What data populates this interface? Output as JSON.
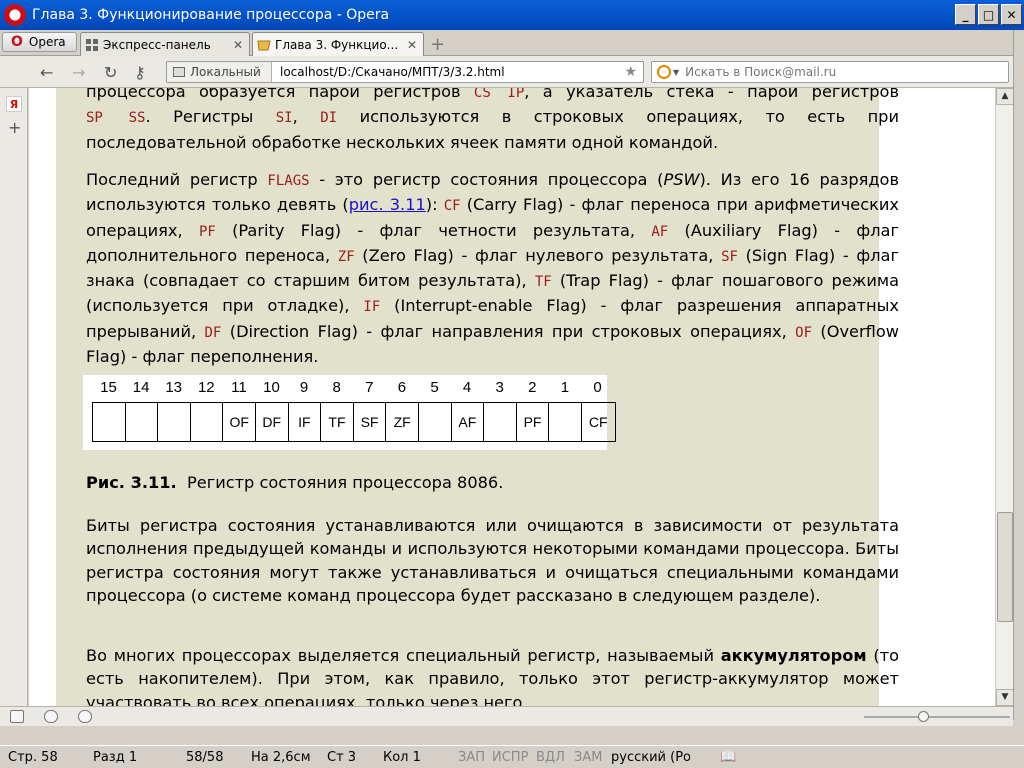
{
  "window": {
    "title": "Глава 3. Функционирование процессора - Opera",
    "buttons": [
      "_",
      "□",
      "✕"
    ]
  },
  "tabs": {
    "menu_label": "Opera",
    "items": [
      {
        "label": "Экспресс-панель",
        "close": "✕"
      },
      {
        "label": "Глава 3. Функцио...",
        "close": "✕"
      }
    ],
    "new_tab": "+"
  },
  "addressbar": {
    "back": "←",
    "forward": "→",
    "reload": "↻",
    "key": "⚷",
    "local_label": "Локальный",
    "url": "localhost/D:/Скачано/МПТ/3/3.2.html",
    "star": "★",
    "search_placeholder": "Искать в Поиск@mail.ru"
  },
  "sidepanel": {
    "y": "Я",
    "plus": "+"
  },
  "content": {
    "para0": {
      "l1_a": "процессора образуется парой регистров ",
      "l1_code1": "CS IP",
      "l1_b": ", а указатель стека - парой регистров",
      "l2_code1": "SP SS",
      "l2_a": ". Регистры ",
      "l2_code2": "SI",
      "l2_b": ", ",
      "l2_code3": "DI",
      "l2_c": " используются в строковых операциях, то есть при",
      "l3": "последовательной обработке нескольких ячеек памяти одной командой."
    },
    "para1": {
      "a": "Последний регистр ",
      "flags": "FLAGS",
      "b": " - это регистр состояния процессора (",
      "psw": "PSW",
      "c": "). Из его 16 разрядов используются только девять (",
      "link": "рис. 3.11",
      "d": "): ",
      "cf": "CF",
      "e": " (Carry Flag) - флаг переноса при арифметических операциях, ",
      "pf": "PF",
      "f": " (Parity Flag) - флаг четности результата, ",
      "af": "AF",
      "g": " (Auxiliary Flag) - флаг дополнительного переноса, ",
      "zf": "ZF",
      "h": " (Zero Flag) - флаг нулевого результата, ",
      "sf": "SF",
      "i": " (Sign Flag) - флаг знака (совпадает со старшим битом результата), ",
      "tf": "TF",
      "j": " (Trap Flag) - флаг пошагового режима (используется при отладке), ",
      "iflag": "IF",
      "k": " (Interrupt-enable Flag) - флаг разрешения аппаратных прерываний, ",
      "df": "DF",
      "l": " (Direction Flag) - флаг направления при строковых операциях, ",
      "of": "OF",
      "m": " (Overflow Flag) - флаг переполнения."
    },
    "register": {
      "bits": [
        "15",
        "14",
        "13",
        "12",
        "11",
        "10",
        "9",
        "8",
        "7",
        "6",
        "5",
        "4",
        "3",
        "2",
        "1",
        "0"
      ],
      "cells": [
        "",
        "",
        "",
        "",
        "OF",
        "DF",
        "IF",
        "TF",
        "SF",
        "ZF",
        "",
        "AF",
        "",
        "PF",
        "",
        "CF"
      ]
    },
    "caption": {
      "label": "Рис. 3.11.",
      "text": "Регистр состояния процессора 8086."
    },
    "para2": "Биты регистра состояния устанавливаются или очищаются в зависимости от результата исполнения предыдущей команды и используются некоторыми командами процессора. Биты регистра состояния могут также устанавливаться и очищаться специальными командами процессора (о системе команд процессора будет рассказано в следующем разделе).",
    "para3": {
      "a": "Во многих процессорах выделяется специальный регистр, называемый ",
      "bold": "аккумулятором",
      "b": " (то есть накопителем). При этом, как правило, только этот регистр-аккумулятор может участвовать во всех операциях, только через него"
    }
  },
  "scrollbar": {
    "up": "▲",
    "down": "▼"
  },
  "statusbar": {
    "page": "Стр. 58",
    "section": "Разд 1",
    "pages": "58/58",
    "at": "На 2,6см",
    "line": "Ст 3",
    "col": "Кол 1",
    "rec": "ЗАП",
    "trk": "ИСПР",
    "ext": "ВДЛ",
    "ovr": "ЗАМ",
    "lang": "русский (Ро"
  }
}
